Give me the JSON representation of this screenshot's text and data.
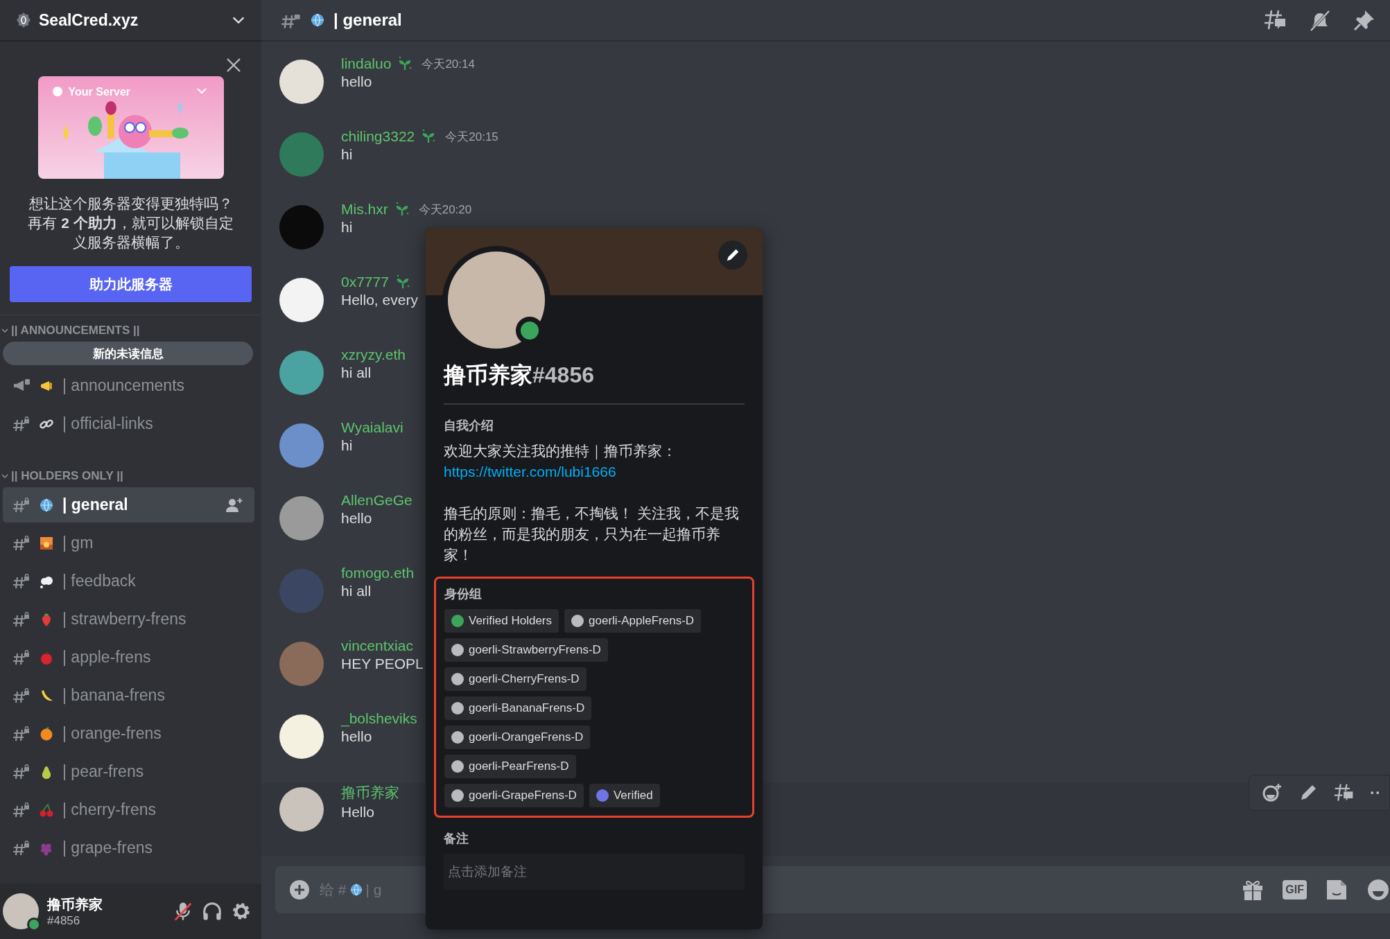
{
  "server": {
    "name": "SealCred.xyz"
  },
  "boost": {
    "illustration_title": "Your Server",
    "text": "想让这个服务器变得更独特吗？再有 **2 个助力**，就可以解锁自定义服务器横幅了。",
    "button": "助力此服务器"
  },
  "unread_pill": "新的未读信息",
  "categories": [
    {
      "name": "|| ANNOUNCEMENTS ||",
      "expanded": true,
      "channels": [
        {
          "name": "| announcements",
          "kind": "announcement",
          "emoji": {
            "kind": "megaphone"
          },
          "selected": false
        },
        {
          "name": "| official-links",
          "kind": "text",
          "emoji": {
            "kind": "link"
          },
          "selected": false
        }
      ]
    },
    {
      "name": "|| HOLDERS ONLY ||",
      "expanded": true,
      "channels": [
        {
          "name": "| general",
          "kind": "text",
          "emoji": {
            "kind": "globe"
          },
          "selected": true
        },
        {
          "name": "| gm",
          "kind": "text",
          "emoji": {
            "kind": "sunrise"
          },
          "selected": false
        },
        {
          "name": "| feedback",
          "kind": "text",
          "emoji": {
            "kind": "cloud"
          },
          "selected": false
        },
        {
          "name": "| strawberry-frens",
          "kind": "text",
          "emoji": {
            "kind": "strawberry"
          },
          "selected": false
        },
        {
          "name": "| apple-frens",
          "kind": "text",
          "emoji": {
            "kind": "apple"
          },
          "selected": false
        },
        {
          "name": "| banana-frens",
          "kind": "text",
          "emoji": {
            "kind": "banana"
          },
          "selected": false
        },
        {
          "name": "| orange-frens",
          "kind": "text",
          "emoji": {
            "kind": "orange"
          },
          "selected": false
        },
        {
          "name": "| pear-frens",
          "kind": "text",
          "emoji": {
            "kind": "pear"
          },
          "selected": false
        },
        {
          "name": "| cherry-frens",
          "kind": "text",
          "emoji": {
            "kind": "cherry"
          },
          "selected": false
        },
        {
          "name": "| grape-frens",
          "kind": "text",
          "emoji": {
            "kind": "grape"
          },
          "selected": false
        }
      ]
    }
  ],
  "user": {
    "name": "撸币养家",
    "tag": "#4856",
    "online": true,
    "mic_muted": true
  },
  "header": {
    "emoji": {
      "kind": "globe"
    },
    "name": "| general"
  },
  "messages": [
    {
      "author": "lindaluo",
      "badge": true,
      "time": "今天20:14",
      "text": "hello",
      "hovered": false
    },
    {
      "author": "chiling3322",
      "badge": true,
      "time": "今天20:15",
      "text": "hi",
      "hovered": false
    },
    {
      "author": "Mis.hxr",
      "badge": true,
      "time": "今天20:20",
      "text": "hi",
      "hovered": false
    },
    {
      "author": "0x7777",
      "badge": true,
      "text": "Hello, every",
      "hovered": false
    },
    {
      "author": "xzryzy.eth",
      "badge": false,
      "text": "hi all",
      "hovered": false
    },
    {
      "author": "Wyaialavi",
      "badge": false,
      "text": "hi",
      "hovered": false
    },
    {
      "author": "AllenGeGe",
      "badge": false,
      "text": "hello",
      "hovered": false
    },
    {
      "author": "fomogo.eth",
      "badge": false,
      "text": "hi all",
      "hovered": false
    },
    {
      "author": "vincentxiac",
      "badge": false,
      "text": "HEY PEOPL",
      "hovered": false
    },
    {
      "author": "_bolsheviks",
      "badge": false,
      "text": "hello",
      "hovered": false
    },
    {
      "author": "撸币养家",
      "badge": false,
      "text": "Hello",
      "hovered": true
    }
  ],
  "composer": {
    "prefix": "给 #",
    "emoji": {
      "kind": "globe"
    },
    "suffix": "| g",
    "gif_label": "GIF"
  },
  "profile": {
    "name": "撸币养家",
    "tag": "#4856",
    "online": true,
    "bio": {
      "title": "自我介绍",
      "intro": "欢迎大家关注我的推特｜撸币养家：",
      "link": "https://twitter.com/lubi1666",
      "body": "撸毛的原则：撸毛，不掏钱！ 关注我，不是我的粉丝，而是我的朋友，只为在一起撸币养家！"
    },
    "roles": {
      "title": "身份组",
      "highlighted": true,
      "items": [
        {
          "name": "Verified Holders",
          "color": "#3ba55c"
        },
        {
          "name": "goerli-AppleFrens-D",
          "color": "#b9bbbe"
        },
        {
          "name": "goerli-StrawberryFrens-D",
          "color": "#b9bbbe"
        },
        {
          "name": "goerli-CherryFrens-D",
          "color": "#b9bbbe"
        },
        {
          "name": "goerli-BananaFrens-D",
          "color": "#b9bbbe"
        },
        {
          "name": "goerli-OrangeFrens-D",
          "color": "#b9bbbe"
        },
        {
          "name": "goerli-PearFrens-D",
          "color": "#b9bbbe"
        },
        {
          "name": "goerli-GrapeFrens-D",
          "color": "#b9bbbe"
        },
        {
          "name": "Verified",
          "color": "#6f74e8"
        }
      ]
    },
    "note": {
      "title": "备注",
      "placeholder": "点击添加备注"
    }
  }
}
